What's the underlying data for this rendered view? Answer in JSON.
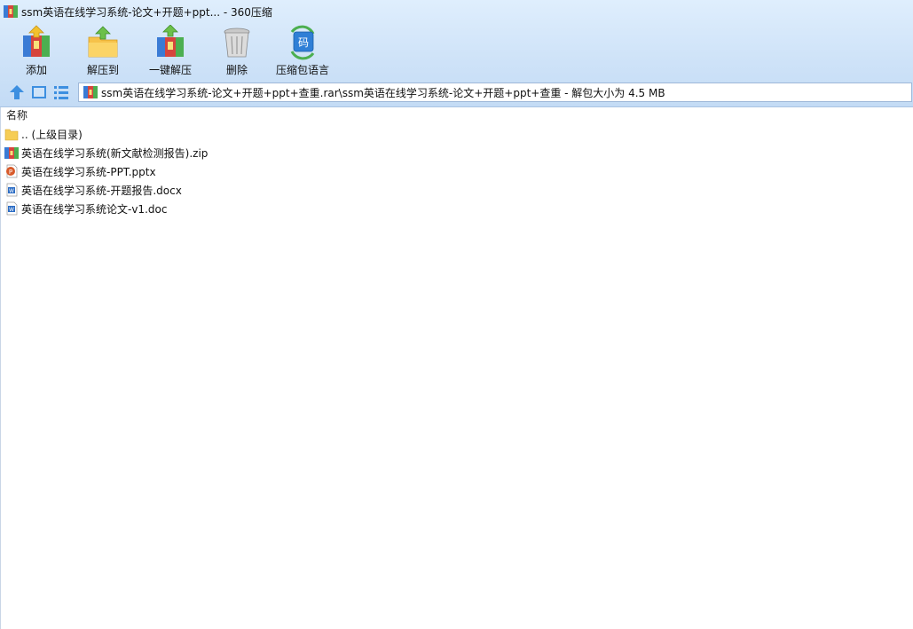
{
  "window": {
    "title": "ssm英语在线学习系统-论文+开题+ppt... - 360压缩"
  },
  "toolbar": {
    "items": [
      {
        "label": "添加",
        "icon": "add-archive-icon"
      },
      {
        "label": "解压到",
        "icon": "extract-to-icon"
      },
      {
        "label": "一键解压",
        "icon": "one-click-extract-icon"
      },
      {
        "label": "删除",
        "icon": "delete-icon"
      },
      {
        "label": "压缩包语言",
        "icon": "archive-language-icon"
      }
    ]
  },
  "address": {
    "path": "ssm英语在线学习系统-论文+开题+ppt+查重.rar\\ssm英语在线学习系统-论文+开题+ppt+查重 - 解包大小为 4.5 MB"
  },
  "list": {
    "column_name": "名称",
    "items": [
      {
        "name": ".. (上级目录)",
        "icon": "folder-icon"
      },
      {
        "name": "英语在线学习系统(新文献检测报告).zip",
        "icon": "zip-archive-icon"
      },
      {
        "name": "英语在线学习系统-PPT.pptx",
        "icon": "pptx-file-icon"
      },
      {
        "name": "英语在线学习系统-开题报告.docx",
        "icon": "docx-file-icon"
      },
      {
        "name": "英语在线学习系统论文-v1.doc",
        "icon": "doc-file-icon"
      }
    ]
  },
  "colors": {
    "chrome_top": "#dfeefd",
    "chrome_bottom": "#c3dbf5",
    "accent": "#3d8fe0"
  }
}
